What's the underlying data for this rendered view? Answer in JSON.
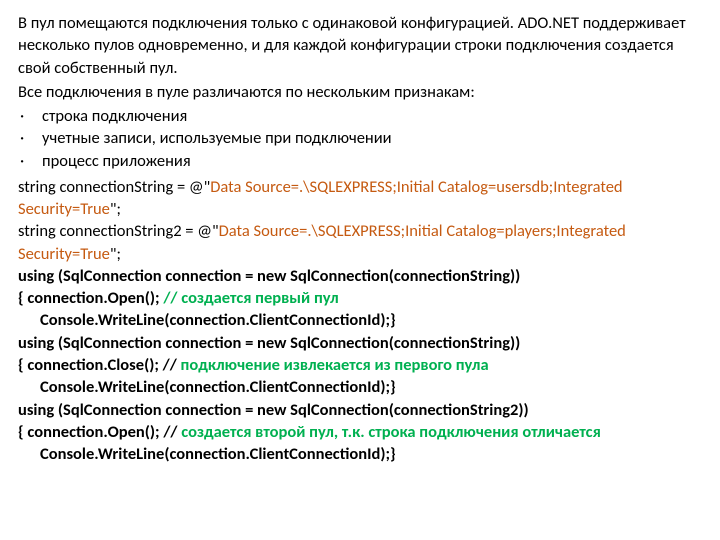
{
  "intro1": "В пул помещаются подключения только с одинаковой конфигурацией. ADO.NET поддерживает несколько пулов одновременно, и для каждой конфигурации строки подключения создается свой собственный пул.",
  "intro2": "Все подключения в пуле различаются по нескольким признакам:",
  "bullets": [
    "строка подключения",
    "учетные записи, используемые при подключении",
    "процесс приложения"
  ],
  "cs1_a": "string connectionString = @\"",
  "cs1_b": "Data Source=.\\SQLEXPRESS;Initial Catalog=usersdb;Integrated Security=True",
  "cs1_c": "\";",
  "cs2_a": "string connectionString2 = @\"",
  "cs2_b": "Data Source=.\\SQLEXPRESS;Initial Catalog=players;Integrated Security=True",
  "cs2_c": "\";",
  "u1": "using (SqlConnection connection = new SqlConnection(connectionString))",
  "u1b1": "{    connection.Open(); ",
  "u1b1_c": "// создается первый пул",
  "u1b2": "Console.WriteLine(connection.ClientConnectionId);}",
  "u2": "using (SqlConnection connection = new SqlConnection(connectionString))",
  "u2b1": "{    connection.Close(); // ",
  "u2b1_c": "подключение извлекается из первого пула",
  "u2b2": "Console.WriteLine(connection.ClientConnectionId);}",
  "u3": "using (SqlConnection connection = new SqlConnection(connectionString2))",
  "u3b1": "{  connection.Open(); // ",
  "u3b1_c": "создается второй пул, т.к. строка подключения отличается",
  "u3b2": "Console.WriteLine(connection.ClientConnectionId);}"
}
